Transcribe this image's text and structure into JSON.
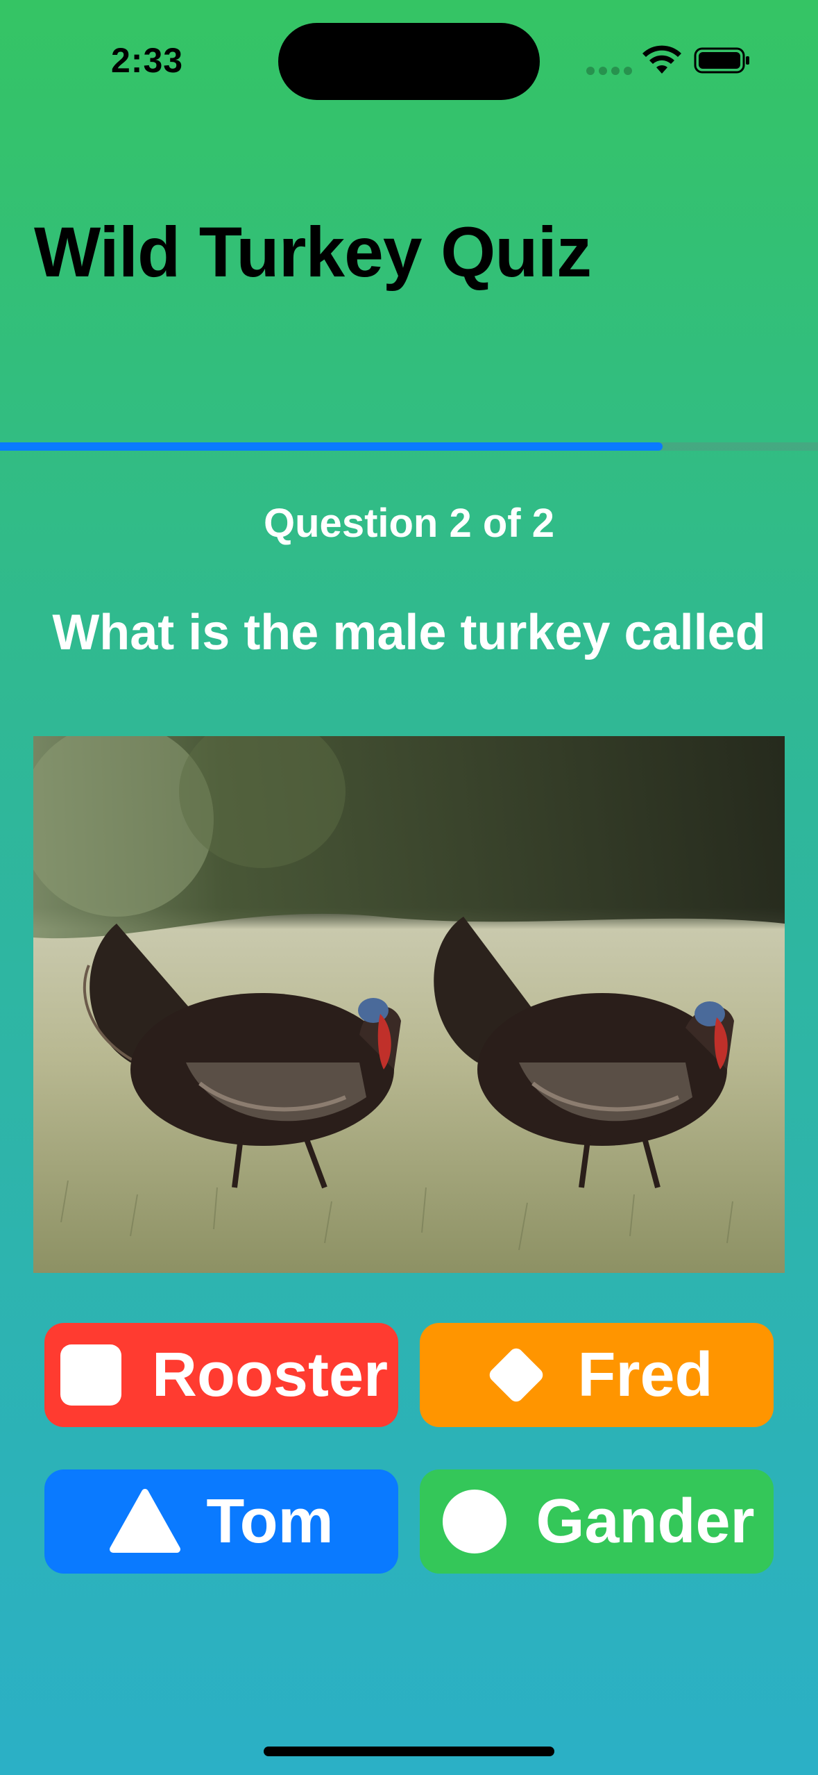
{
  "status_bar": {
    "time": "2:33"
  },
  "title": "Wild Turkey Quiz",
  "progress": {
    "fraction": 0.81
  },
  "question": {
    "counter": "Question 2 of 2",
    "text": "What is the male turkey called"
  },
  "answers": [
    {
      "label": "Rooster",
      "shape": "square-icon",
      "color": "#ff3b30"
    },
    {
      "label": "Fred",
      "shape": "diamond-icon",
      "color": "#ff9500"
    },
    {
      "label": "Tom",
      "shape": "triangle-icon",
      "color": "#0a7aff"
    },
    {
      "label": "Gander",
      "shape": "circle-icon",
      "color": "#34c759"
    }
  ],
  "colors": {
    "progress": "#0a7aff",
    "gradient_top": "#35c464",
    "gradient_bottom": "#2bb0c6"
  }
}
